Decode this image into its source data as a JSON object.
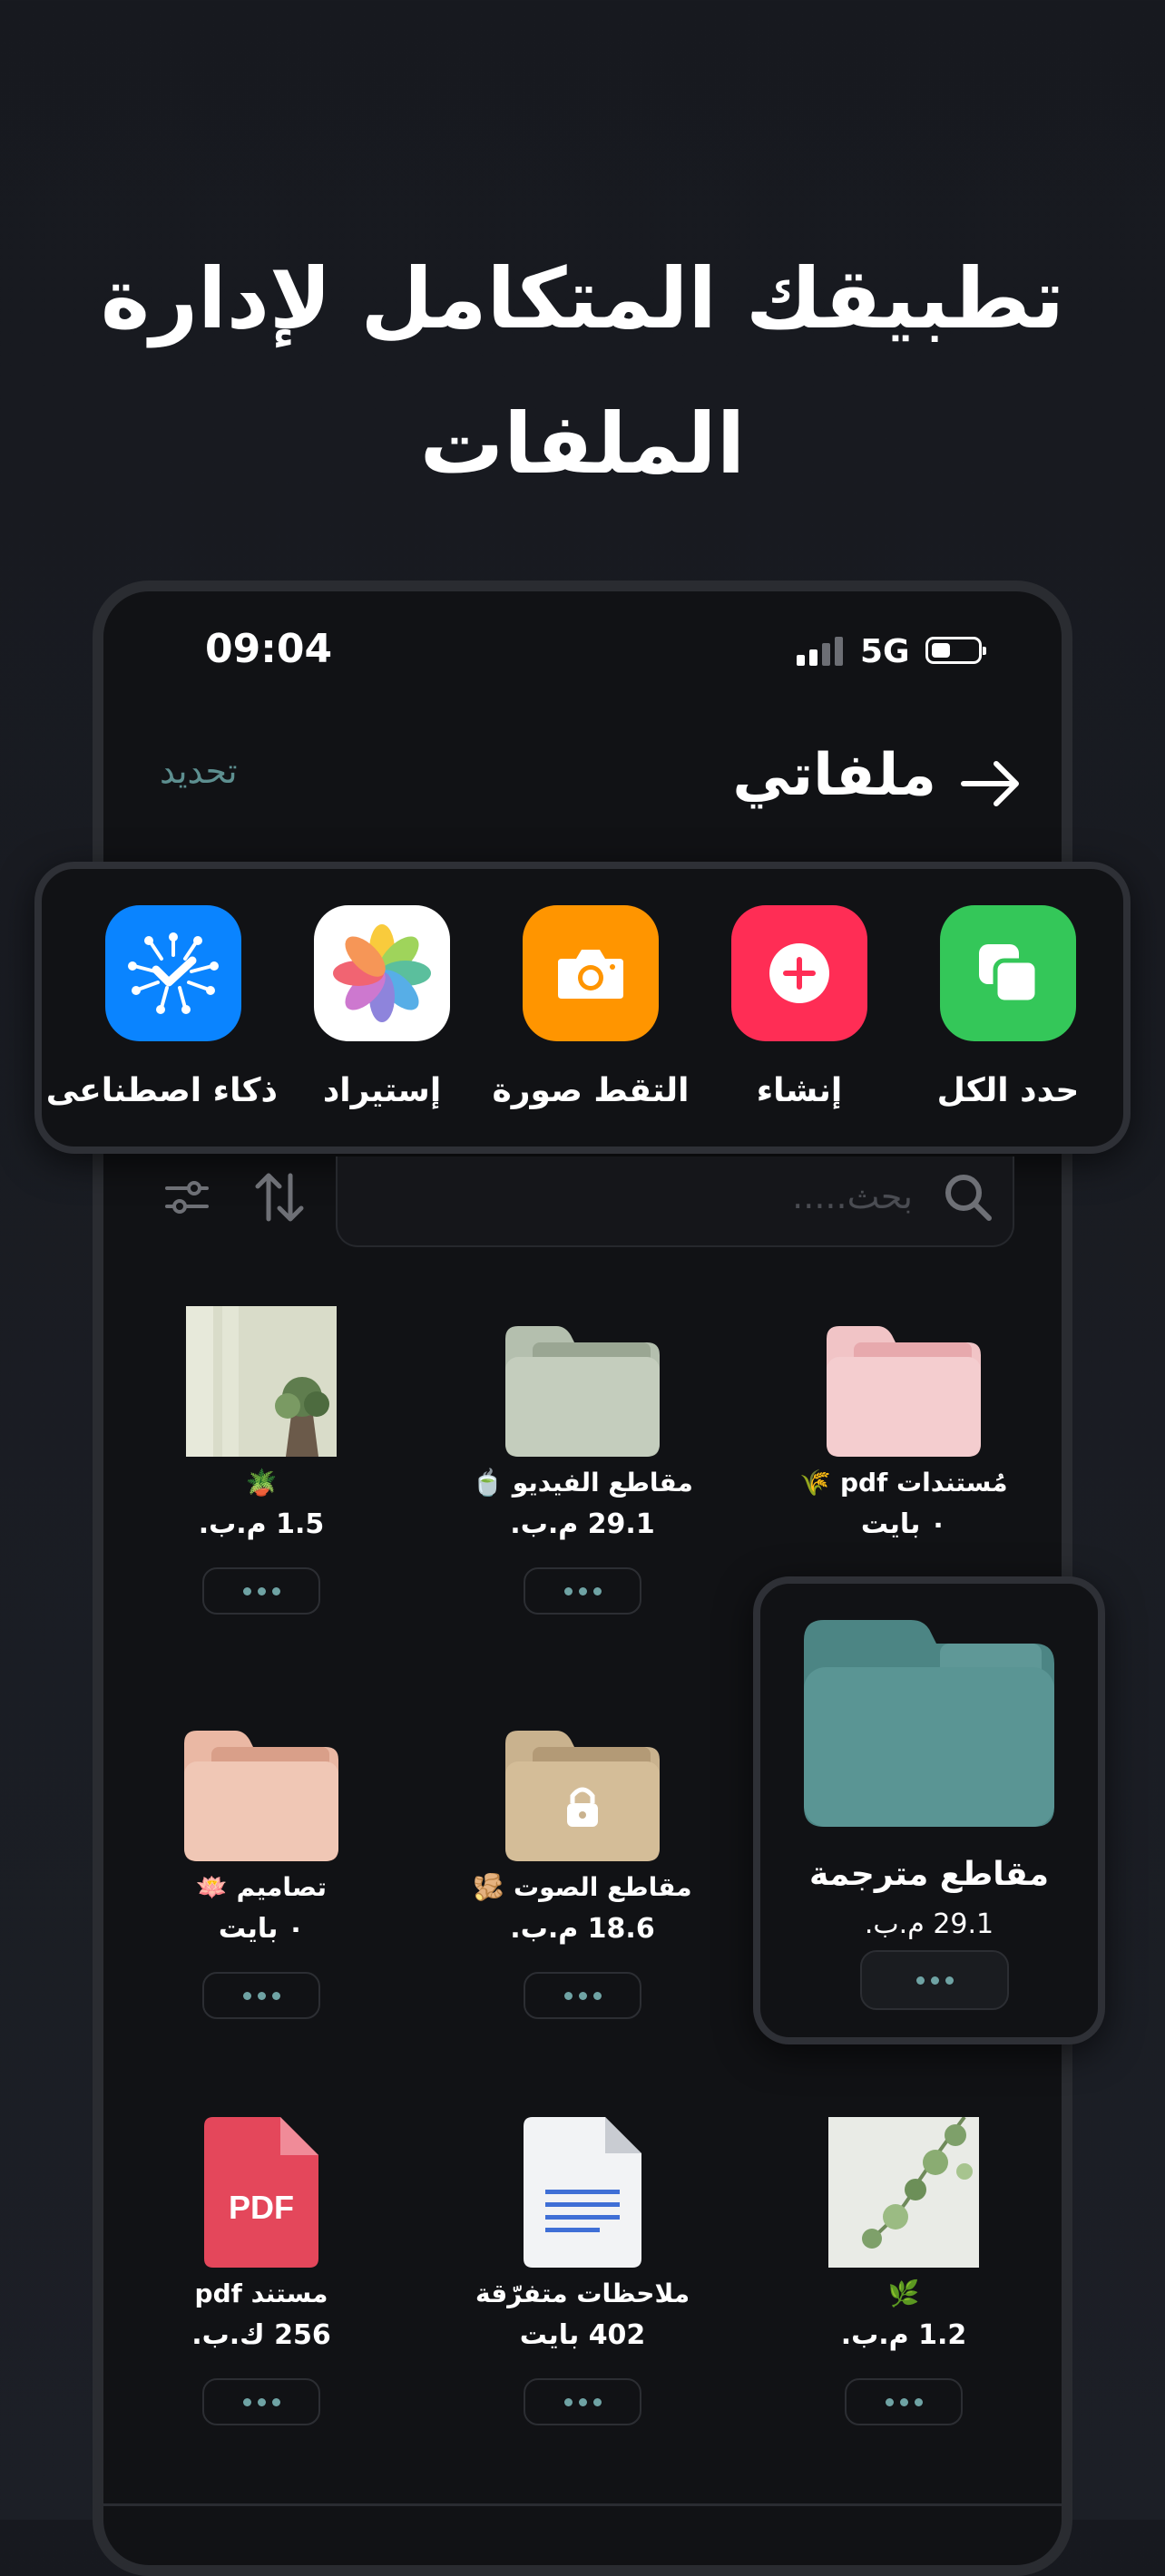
{
  "promo": {
    "line1": "تطبيقك المتكامل لإدارة",
    "line2": "الملفات"
  },
  "status_bar": {
    "time": "09:04",
    "network": "5G"
  },
  "header": {
    "title": "ملفاتي",
    "update_label": "تحديد"
  },
  "actions": [
    {
      "label": "حدد الكل",
      "icon": "copy-icon",
      "color": "#34c759"
    },
    {
      "label": "إنشاء",
      "icon": "plus-circle-icon",
      "color": "#ff2d55"
    },
    {
      "label": "التقط صورة",
      "icon": "camera-icon",
      "color": "#ff9500"
    },
    {
      "label": "إستيراد",
      "icon": "photos-icon",
      "color": "#ffffff"
    },
    {
      "label": "ذكاء اصطناعى",
      "icon": "ai-chip-icon",
      "color": "#0a84ff"
    }
  ],
  "search": {
    "placeholder": "بحث....."
  },
  "files": [
    {
      "name": "مُستندات pdf 🌾",
      "size": "٠ بايت",
      "type": "folder-pink"
    },
    {
      "name": "مقاطع الفيديو 🍵",
      "size": "29.1 م.ب.",
      "type": "folder-sage"
    },
    {
      "name": "🪴",
      "size": "1.5 م.ب.",
      "type": "photo"
    },
    {
      "name": "مقاطع الصوت 🫚",
      "size": "18.6 م.ب.",
      "type": "folder-tan-locked"
    },
    {
      "name": "تصاميم 🪷",
      "size": "٠ بايت",
      "type": "folder-peach"
    },
    {
      "name": "🌿",
      "size": "1.2 م.ب.",
      "type": "photo-vine"
    },
    {
      "name": "ملاحظات متفرّقة",
      "size": "402 بايت",
      "type": "document"
    },
    {
      "name": "مستند pdf",
      "size": "256 ك.ب.",
      "type": "pdf"
    }
  ],
  "featured": {
    "name": "مقاطع مترجمة",
    "size": "29.1 م.ب."
  },
  "colors": {
    "accent": "#5d8f90",
    "background": "#17191f",
    "dots": "#6fa3a4",
    "featured_folder": "#5a9594"
  }
}
